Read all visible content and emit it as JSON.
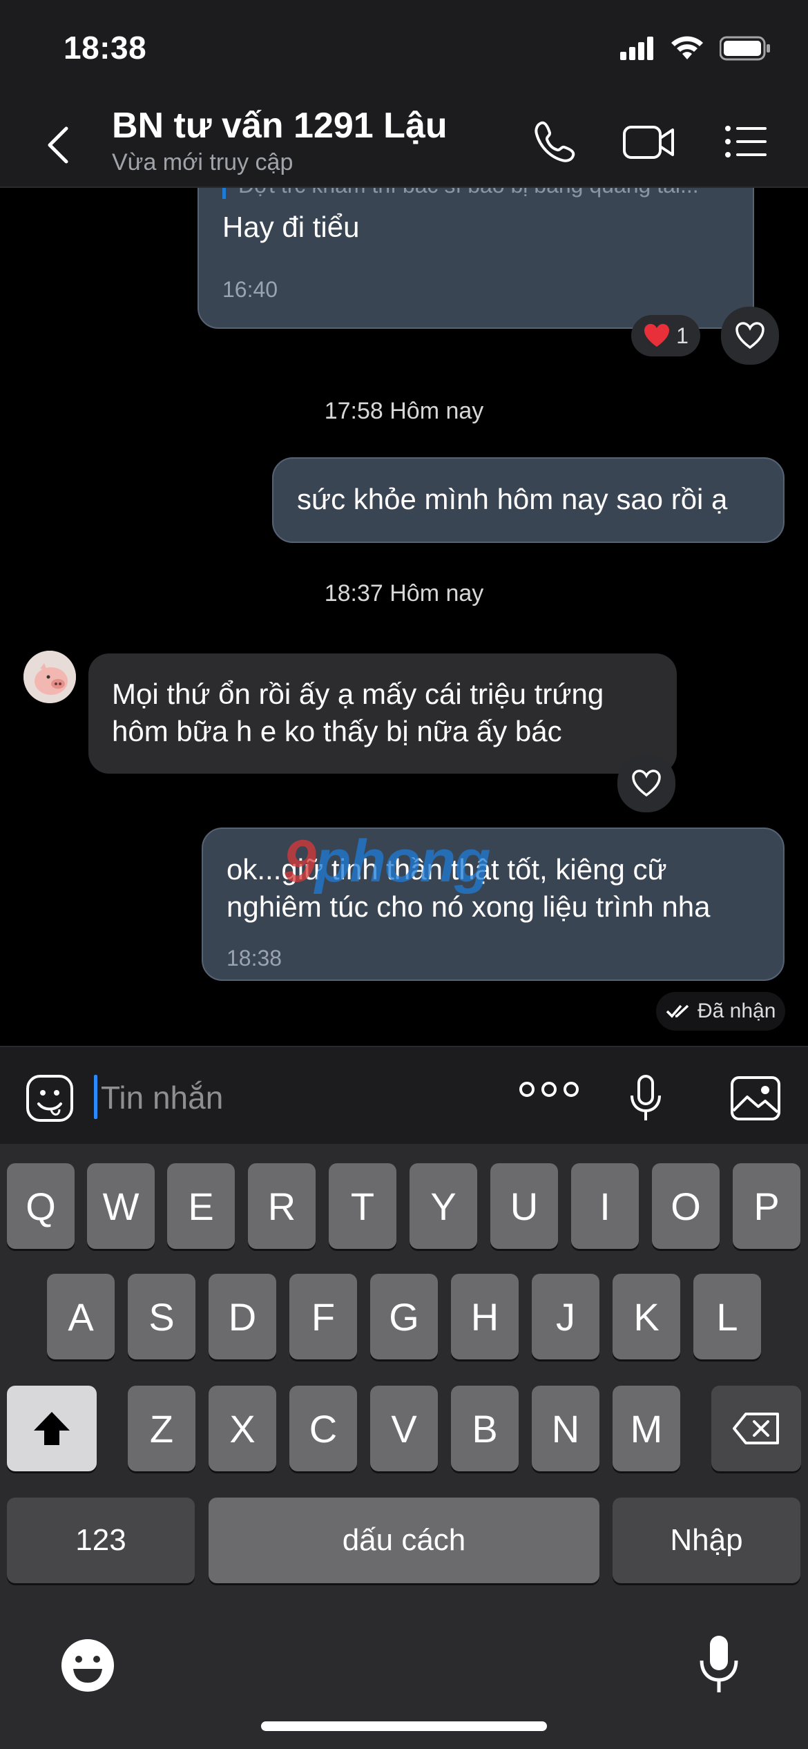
{
  "status_bar": {
    "time": "18:38"
  },
  "header": {
    "title": "BN tư vấn 1291 Lậu",
    "subtitle": "Vừa mới truy cập"
  },
  "messages": {
    "m1": {
      "text": "Hay đi tiểu",
      "time": "16:40",
      "reaction_count": "1",
      "quote_partial": "Đợt trc khám thì bác sĩ bảo bị bàng quang tái..."
    },
    "sep1": "17:58 Hôm nay",
    "m2": {
      "text": "sức khỏe mình hôm nay sao rồi ạ"
    },
    "sep2": "18:37 Hôm nay",
    "m3": {
      "line1": "Mọi thứ ổn rồi ấy ạ mấy cái triệu trứng",
      "line2": "hôm bữa h e ko thấy bị nữa ấy bác"
    },
    "m4": {
      "line1": "ok...giữ tinh thần thật tốt, kiêng cữ",
      "line2": "nghiêm túc cho nó xong liệu trình nha",
      "time": "18:38",
      "status": "Đã nhận"
    }
  },
  "watermark": {
    "prefix": "9",
    "text": "phong"
  },
  "composer": {
    "placeholder": "Tin nhắn",
    "more": "ooo"
  },
  "keyboard": {
    "row1": [
      "Q",
      "W",
      "E",
      "R",
      "T",
      "Y",
      "U",
      "I",
      "O",
      "P"
    ],
    "row2": [
      "A",
      "S",
      "D",
      "F",
      "G",
      "H",
      "J",
      "K",
      "L"
    ],
    "row3": [
      "Z",
      "X",
      "C",
      "V",
      "B",
      "N",
      "M"
    ],
    "numbers": "123",
    "space": "dấu cách",
    "enter": "Nhập"
  },
  "colors": {
    "bubble_out": "#3a4554",
    "bubble_in": "#2c2c2e",
    "accent": "#1e7bd6",
    "heart": "#e8303a"
  }
}
